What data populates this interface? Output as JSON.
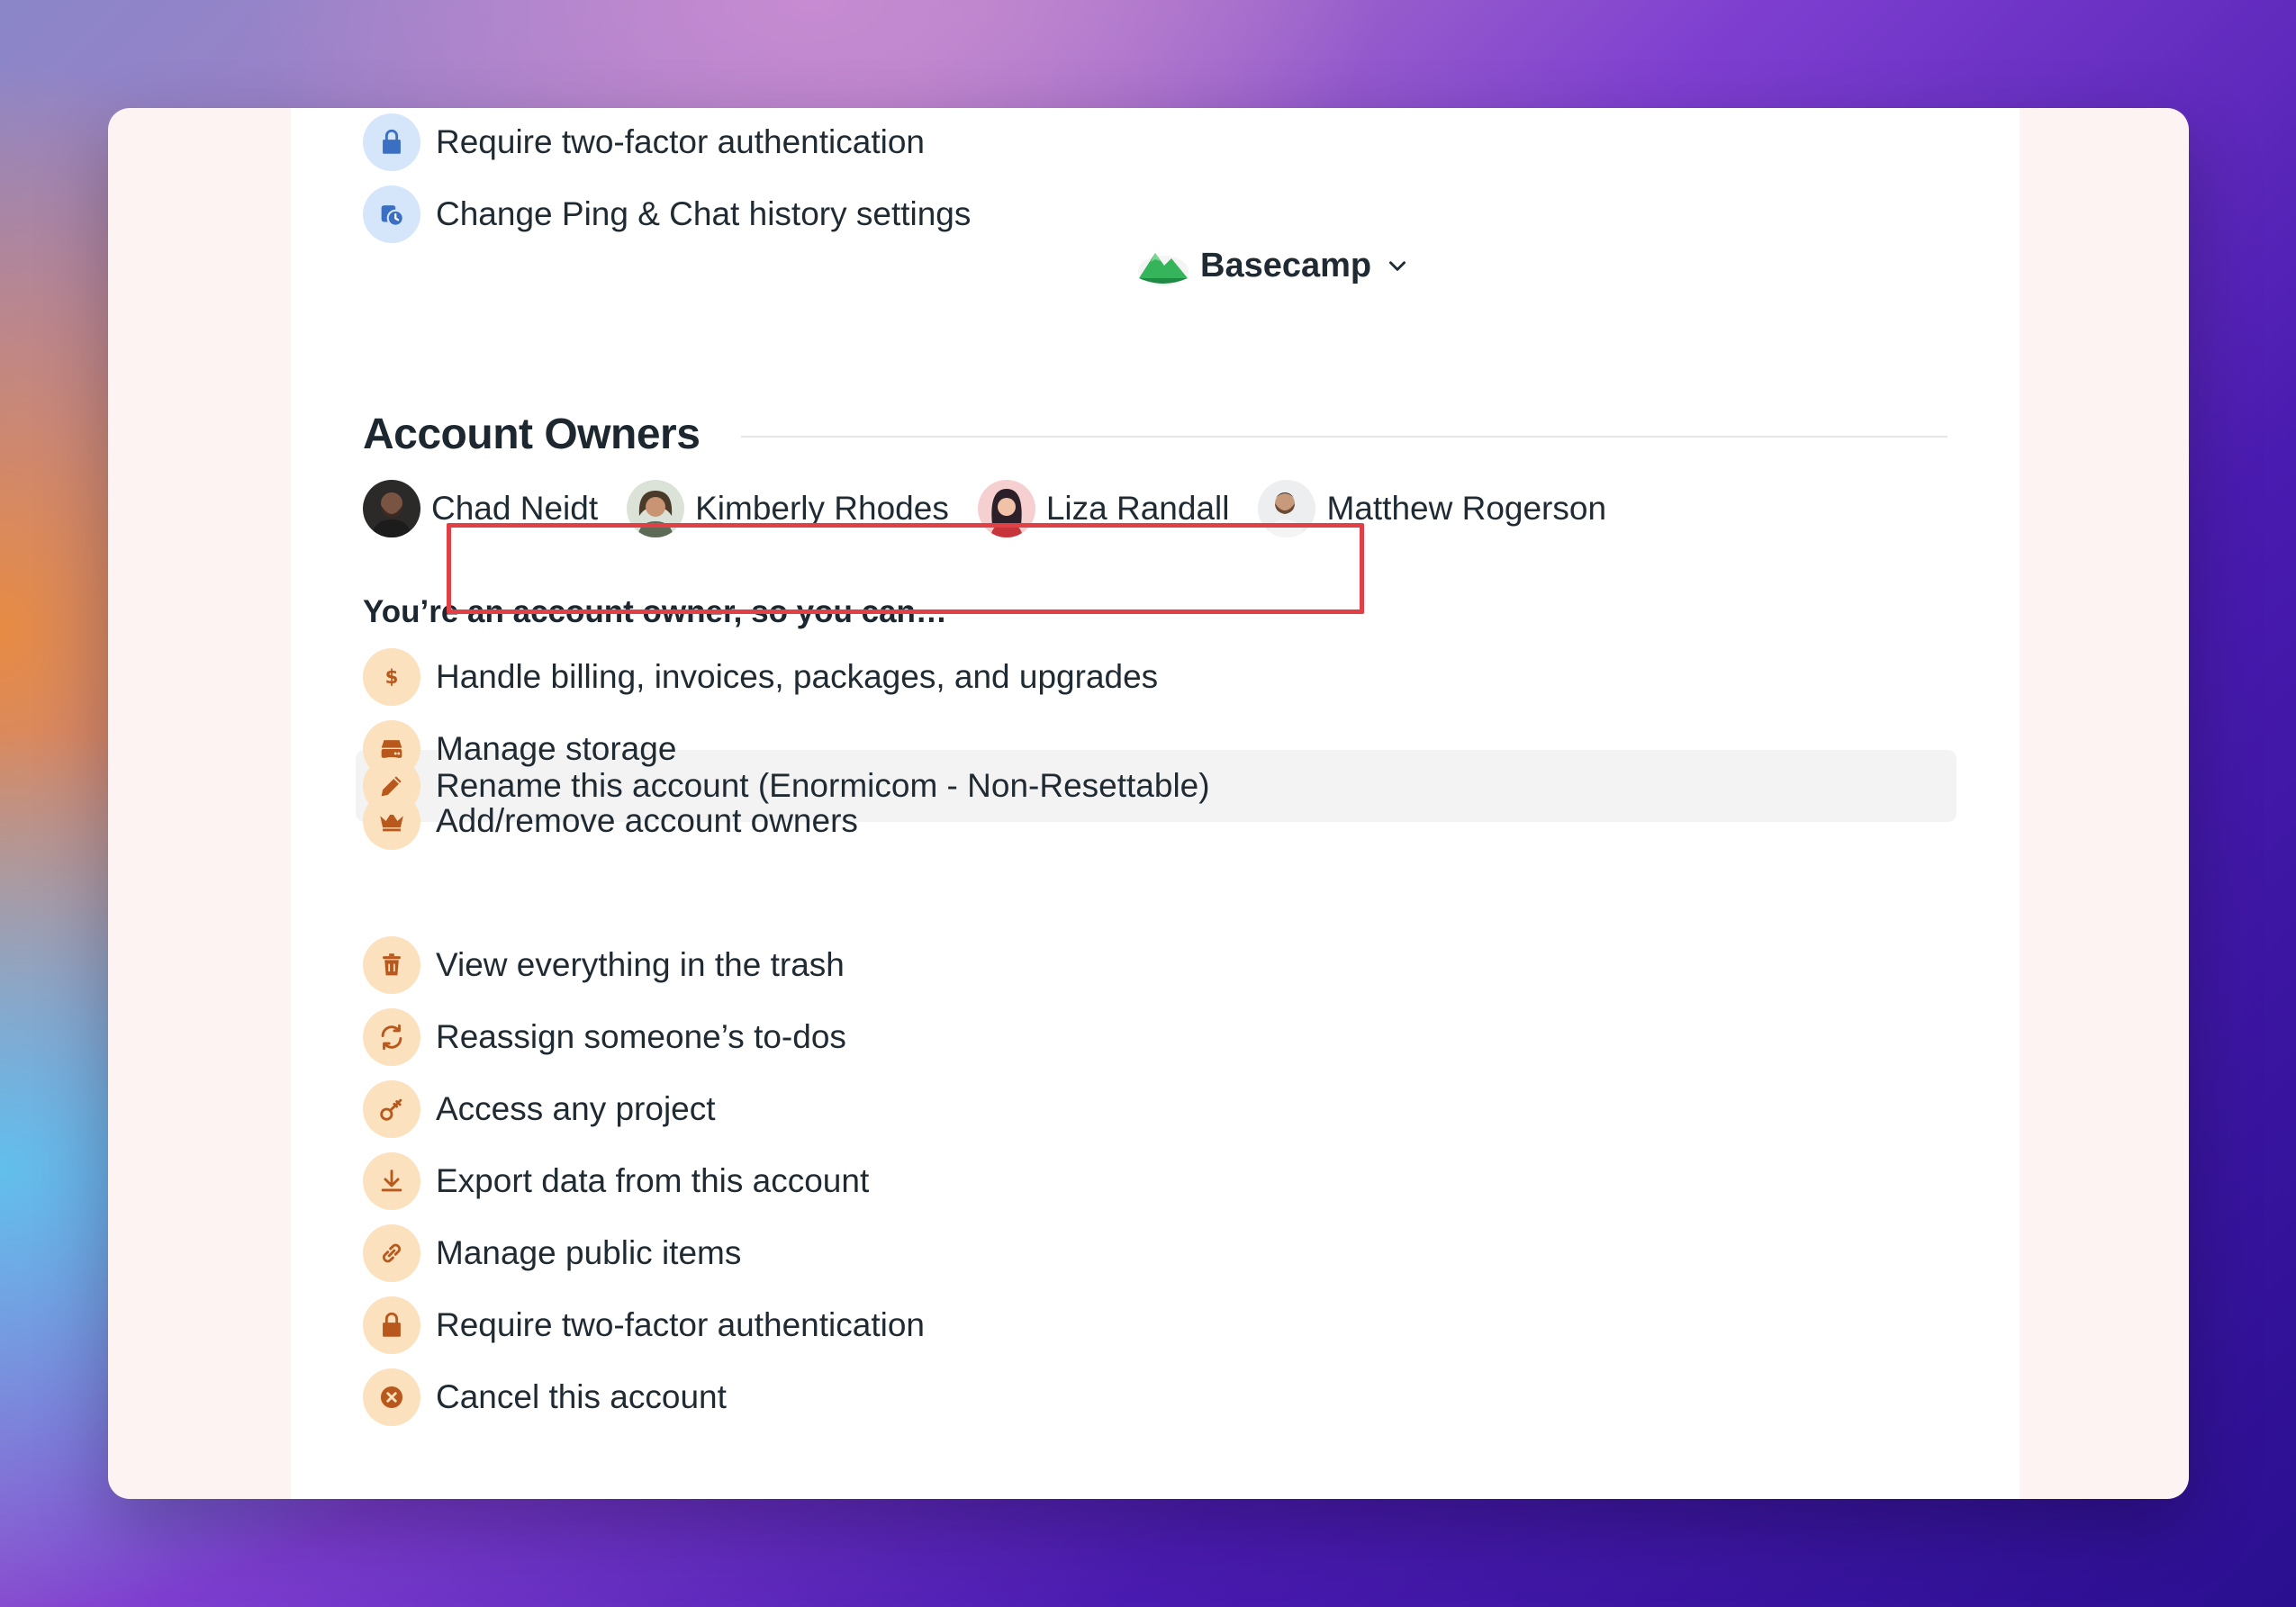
{
  "account_switcher": {
    "name": "Basecamp",
    "logo_icon": "mountain-logo",
    "chevron_icon": "chevron-down-icon"
  },
  "top_items": [
    {
      "label": "Require two-factor authentication",
      "icon": "lock-icon"
    },
    {
      "label": "Change Ping & Chat history settings",
      "icon": "history-clock-icon"
    }
  ],
  "owners_section": {
    "title": "Account Owners",
    "owners": [
      {
        "name": "Chad Neidt"
      },
      {
        "name": "Kimberly Rhodes"
      },
      {
        "name": "Liza Randall"
      },
      {
        "name": "Matthew Rogerson"
      }
    ]
  },
  "permissions": {
    "heading": "You’re an account owner, so you can…",
    "items": [
      {
        "label": "Handle billing, invoices, packages, and upgrades",
        "icon": "dollar-icon"
      },
      {
        "label": "Manage storage",
        "icon": "storage-icon"
      },
      {
        "label": "Add/remove account owners",
        "icon": "crown-icon"
      },
      {
        "label": "Rename this account (Enormicom - Non-Resettable)",
        "icon": "pencil-icon"
      },
      {
        "label": "View everything in the trash",
        "icon": "trash-icon"
      },
      {
        "label": "Reassign someone’s to-dos",
        "icon": "reassign-icon"
      },
      {
        "label": "Access any project",
        "icon": "key-icon"
      },
      {
        "label": "Export data from this account",
        "icon": "download-icon"
      },
      {
        "label": "Manage public items",
        "icon": "link-icon"
      },
      {
        "label": "Require two-factor authentication",
        "icon": "lock-icon"
      },
      {
        "label": "Cancel this account",
        "icon": "cancel-icon"
      }
    ]
  },
  "colors": {
    "icon_blue": "#3a6fc4",
    "icon_orange": "#b8581c",
    "highlight_border": "#e04046"
  }
}
